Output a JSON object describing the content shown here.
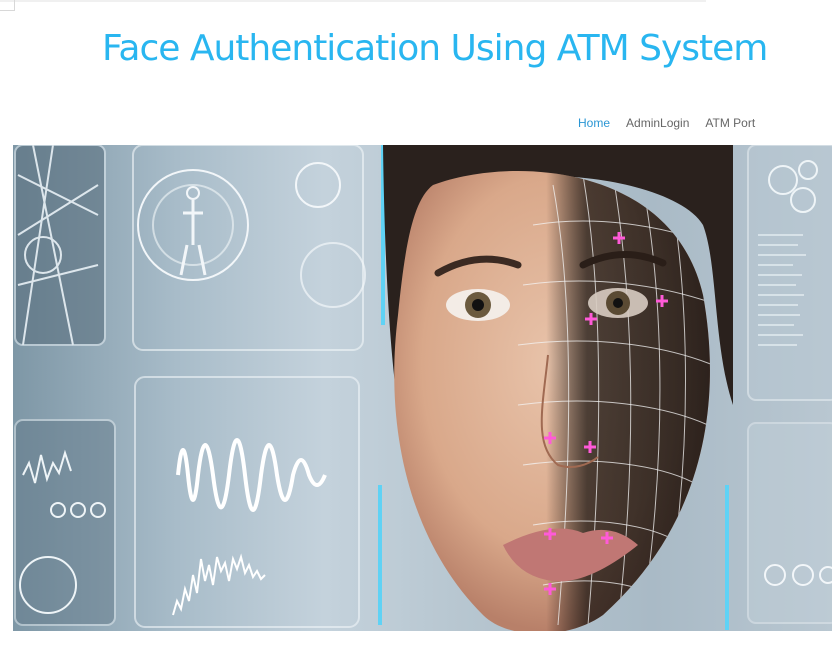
{
  "header": {
    "title": "Face Authentication Using ATM System"
  },
  "nav": {
    "items": [
      {
        "label": "Home",
        "active": true
      },
      {
        "label": "AdminLogin",
        "active": false
      },
      {
        "label": "ATM Port",
        "active": false
      }
    ]
  },
  "colors": {
    "title": "#29b6f0",
    "nav_active": "#2a96d4",
    "nav_default": "#666666",
    "marker": "#ff5ad8"
  },
  "hero": {
    "icon": "face-recognition-banner"
  }
}
